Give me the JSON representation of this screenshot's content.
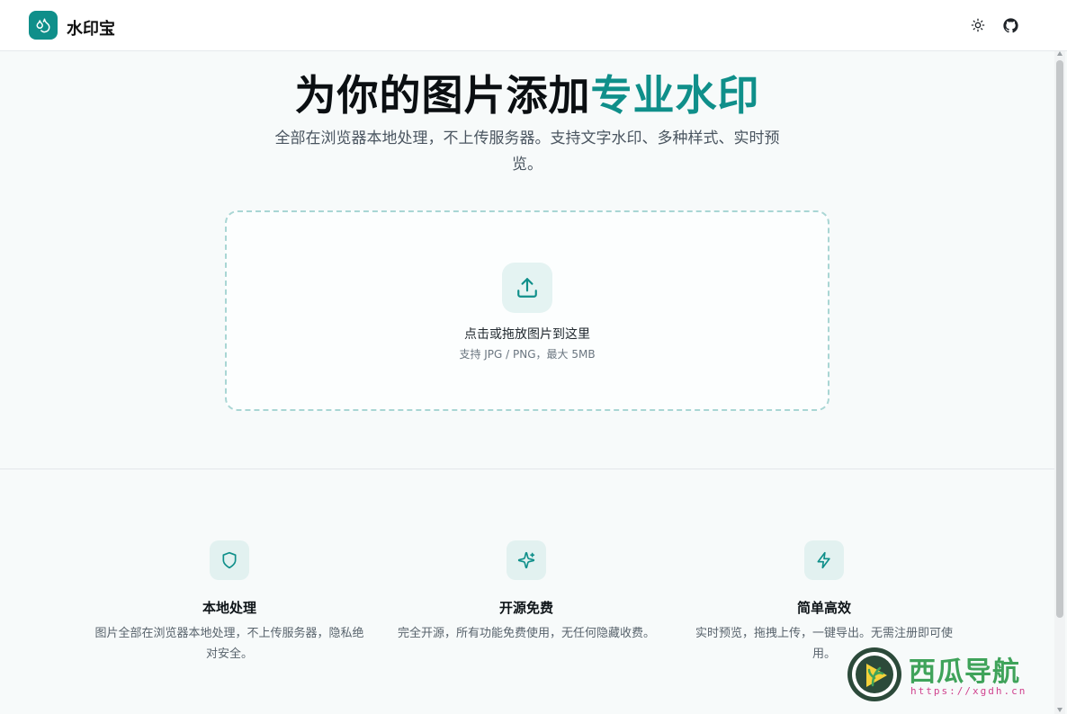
{
  "header": {
    "brand": "水印宝",
    "icons": [
      "sun-icon",
      "github-icon"
    ]
  },
  "hero": {
    "title_main": "为你的图片添加",
    "title_accent": "专业水印",
    "subtitle": "全部在浏览器本地处理，不上传服务器。支持文字水印、多种样式、实时预览。"
  },
  "upload": {
    "title": "点击或拖放图片到这里",
    "hint": "支持 JPG / PNG，最大 5MB"
  },
  "features": [
    {
      "icon": "shield-icon",
      "title": "本地处理",
      "desc": "图片全部在浏览器本地处理，不上传服务器，隐私绝对安全。"
    },
    {
      "icon": "sparkles-icon",
      "title": "开源免费",
      "desc": "完全开源，所有功能免费使用，无任何隐藏收费。"
    },
    {
      "icon": "bolt-icon",
      "title": "简单高效",
      "desc": "实时预览，拖拽上传，一键导出。无需注册即可使用。"
    }
  ],
  "watermark": {
    "name": "西瓜导航",
    "url": "https://xgdh.cn"
  },
  "colors": {
    "accent": "#0f8f8a",
    "background": "#f7fafa"
  }
}
